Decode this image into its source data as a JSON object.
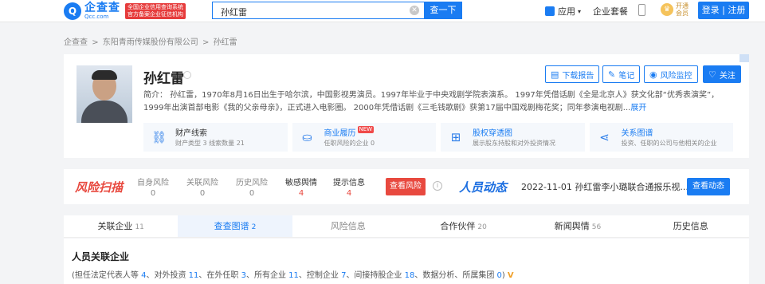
{
  "header": {
    "logo_cn": "企查查",
    "logo_en": "Qcc.com",
    "logo_tag_line1": "全国企业信用查询系统",
    "logo_tag_line2": "官方备案企业征信机构",
    "search_value": "孙红雷",
    "search_button": "查一下",
    "nav_app": "应用",
    "nav_ent": "企业套餐",
    "vip_line1": "开通",
    "vip_line2": "会员",
    "login": "登录 | 注册"
  },
  "breadcrumb": [
    "企查查",
    ">",
    "东阳青雨传媒股份有限公司",
    ">",
    "孙红雷"
  ],
  "profile": {
    "name": "孙红雷",
    "intro_line1": "简介：  孙红雷，1970年8月16日出生于哈尔滨，中国影视男演员。1997年毕业于中央戏剧学院表演系。 1997年凭借话剧《全是北京人》获文化部“优秀表演奖”，",
    "intro_line2": "1999年出演首部电影《我的父亲母亲》，正式进入电影圈。 2000年凭借话剧《三毛钱歌剧》获第17届中国戏剧梅花奖；同年参演电视剧...",
    "intro_more": "展开",
    "actions": {
      "report": "下载报告",
      "note": "笔记",
      "monitor": "风险监控",
      "follow": "关注"
    },
    "tiles": [
      {
        "title": "财产线索",
        "sub": "财产类型 3   线索数量 21",
        "icon": "link-icon",
        "glyph": "⛓"
      },
      {
        "title": "商业履历",
        "badge": "NEW",
        "sub": "任职风险的企业 0",
        "icon": "briefcase-icon",
        "glyph": "⛀"
      },
      {
        "title": "股权穿透图",
        "sub": "展示股东持股和对外投资情况",
        "icon": "org-chart-icon",
        "glyph": "⊞"
      },
      {
        "title": "关系图谱",
        "sub": "投资、任职的公司与他相关的企业",
        "icon": "share-icon",
        "glyph": "⋖"
      }
    ]
  },
  "risk": {
    "logo": "风险扫描",
    "stats": [
      {
        "label": "自身风险",
        "value": "0",
        "hot": false
      },
      {
        "label": "关联风险",
        "value": "0",
        "hot": false
      },
      {
        "label": "历史风险",
        "value": "0",
        "hot": false
      },
      {
        "label": "敏感舆情",
        "value": "4",
        "hot": true
      },
      {
        "label": "提示信息",
        "value": "4",
        "hot": true
      }
    ],
    "button": "查看风险",
    "news_logo": "人员动态",
    "news_text": "2022-11-01  孙红雷李小璐联合通报乐视...",
    "news_button": "查看动态"
  },
  "tabs": [
    {
      "label": "关联企业",
      "count": "11",
      "active": false,
      "dim": false
    },
    {
      "label": "查查图谱",
      "count": "2",
      "active": true,
      "dim": false
    },
    {
      "label": "风险信息",
      "count": "",
      "active": false,
      "dim": true
    },
    {
      "label": "合作伙伴",
      "count": "20",
      "active": false,
      "dim": false
    },
    {
      "label": "新闻舆情",
      "count": "56",
      "active": false,
      "dim": false
    },
    {
      "label": "历史信息",
      "count": "",
      "active": false,
      "dim": false
    }
  ],
  "section": {
    "title": "人员关联企业",
    "stats": [
      {
        "label": "(担任法定代表人等",
        "value": "4"
      },
      {
        "label": "、对外投资",
        "value": "11"
      },
      {
        "label": "、在外任职",
        "value": "3"
      },
      {
        "label": "、所有企业",
        "value": "11"
      },
      {
        "label": "、控制企业",
        "value": "7"
      },
      {
        "label": "、间接持股企业",
        "value": "18"
      },
      {
        "label": "、数据分析、所属集团",
        "value": "0"
      }
    ],
    "stats_close": ")"
  },
  "colors": {
    "brand": "#1a7cf2",
    "risk": "#e8493f"
  }
}
